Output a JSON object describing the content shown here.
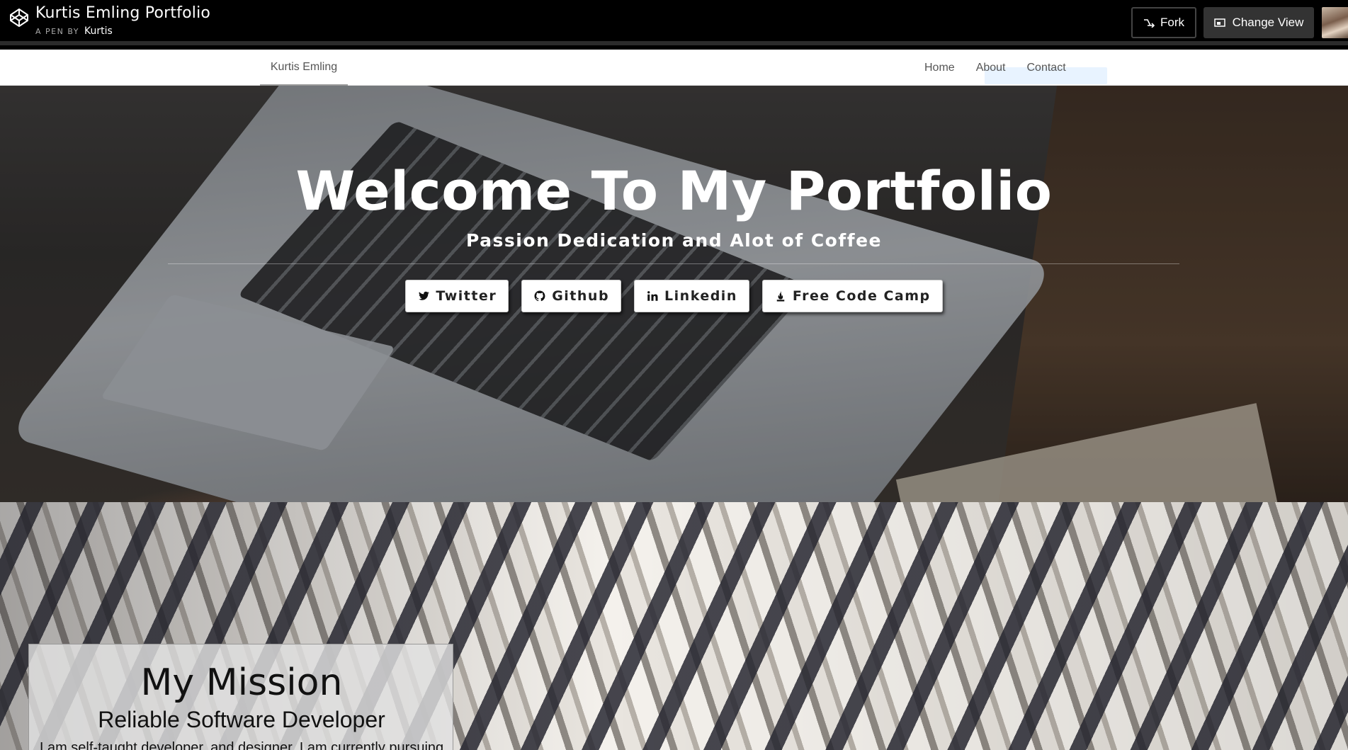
{
  "codepen": {
    "pen_title": "Kurtis Emling Portfolio",
    "byline_prefix": "A PEN BY",
    "author": "Kurtis",
    "fork_label": "Fork",
    "change_view_label": "Change View"
  },
  "nav": {
    "brand": "Kurtis Emling",
    "links": [
      "Home",
      "About",
      "Contact"
    ]
  },
  "hero": {
    "title": "Welcome To My Portfolio",
    "subtitle": "Passion Dedication and Alot of Coffee",
    "buttons": [
      {
        "label": "Twitter",
        "icon": "twitter-icon"
      },
      {
        "label": "Github",
        "icon": "github-icon"
      },
      {
        "label": "Linkedin",
        "icon": "linkedin-icon"
      },
      {
        "label": "Free Code Camp",
        "icon": "free-code-camp-icon"
      }
    ]
  },
  "mission": {
    "title": "My Mission",
    "subtitle": "Reliable Software Developer",
    "text": "I am self-taught developer, and designer. I am currently pursuing"
  }
}
